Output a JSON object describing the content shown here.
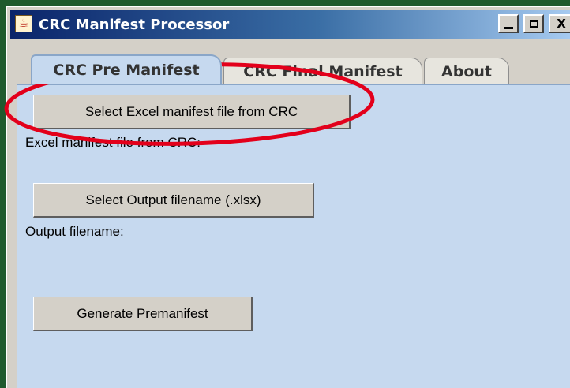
{
  "window": {
    "title": "CRC Manifest Processor",
    "icon": "java-cup-icon",
    "controls": {
      "minimize": "_",
      "maximize": "□",
      "close": "X"
    }
  },
  "tabs": [
    {
      "label": "CRC Pre Manifest",
      "active": true
    },
    {
      "label": "CRC Final Manifest",
      "active": false
    },
    {
      "label": "About",
      "active": false
    }
  ],
  "panel": {
    "select_excel_button": "Select Excel manifest file from CRC",
    "excel_file_label": "Excel manifest file from CRC:",
    "select_output_button": "Select Output filename (.xlsx)",
    "output_filename_label": "Output filename:",
    "generate_button": "Generate Premanifest"
  },
  "colors": {
    "panel_bg": "#c6d9ef",
    "annotation_ellipse": "#e3001b",
    "background": "#1f5a2e"
  }
}
